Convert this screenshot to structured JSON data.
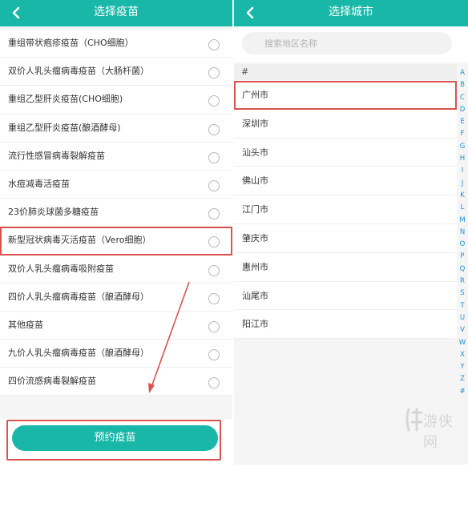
{
  "left_panel": {
    "title": "选择疫苗",
    "vaccines": [
      {
        "name": "重组带状疱疹疫苗（CHO细胞）"
      },
      {
        "name": "双价人乳头瘤病毒疫苗（大肠杆菌）"
      },
      {
        "name": "重组乙型肝炎疫苗(CHO细胞)"
      },
      {
        "name": "重组乙型肝炎疫苗(酿酒酵母)"
      },
      {
        "name": "流行性感冒病毒裂解疫苗"
      },
      {
        "name": "水痘减毒活疫苗"
      },
      {
        "name": "23价肺炎球菌多糖疫苗"
      },
      {
        "name": "新型冠状病毒灭活疫苗（Vero细胞）",
        "highlighted": true
      },
      {
        "name": "双价人乳头瘤病毒吸附疫苗"
      },
      {
        "name": "四价人乳头瘤病毒疫苗（酿酒酵母）"
      },
      {
        "name": "其他疫苗"
      },
      {
        "name": "九价人乳头瘤病毒疫苗（酿酒酵母）"
      },
      {
        "name": "四价流感病毒裂解疫苗"
      }
    ],
    "book_button": "预约疫苗"
  },
  "right_panel": {
    "title": "选择城市",
    "search_placeholder": "搜索地区名称",
    "section_header": "#",
    "cities": [
      {
        "name": "广州市",
        "highlighted": true
      },
      {
        "name": "深圳市"
      },
      {
        "name": "汕头市"
      },
      {
        "name": "佛山市"
      },
      {
        "name": "江门市"
      },
      {
        "name": "肇庆市"
      },
      {
        "name": "惠州市"
      },
      {
        "name": "汕尾市"
      },
      {
        "name": "阳江市"
      }
    ],
    "alphabet": [
      "A",
      "B",
      "C",
      "D",
      "E",
      "F",
      "G",
      "H",
      "I",
      "J",
      "K",
      "L",
      "M",
      "N",
      "O",
      "P",
      "Q",
      "R",
      "S",
      "T",
      "U",
      "V",
      "W",
      "X",
      "Y",
      "Z",
      "#"
    ]
  },
  "watermark": {
    "text": "游侠网"
  },
  "colors": {
    "accent": "#18b7a7",
    "highlight": "#d9534f",
    "index_letters": "#1f8fd6"
  }
}
